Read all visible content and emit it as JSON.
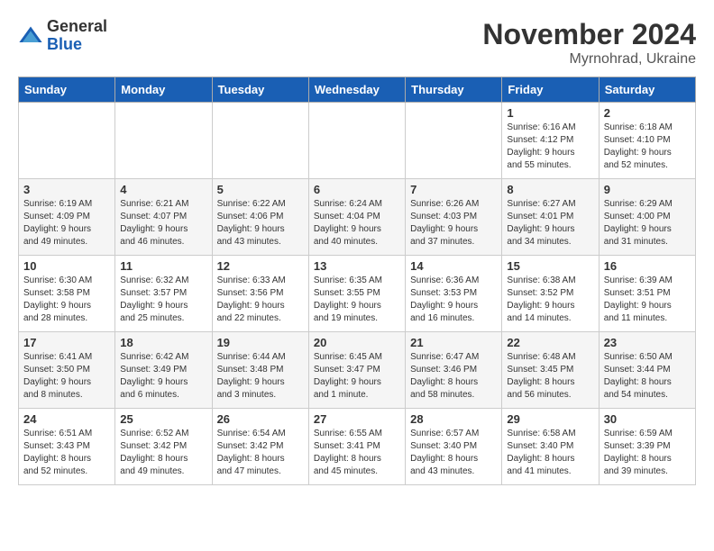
{
  "logo": {
    "general": "General",
    "blue": "Blue"
  },
  "title": "November 2024",
  "subtitle": "Myrnohrad, Ukraine",
  "days_header": [
    "Sunday",
    "Monday",
    "Tuesday",
    "Wednesday",
    "Thursday",
    "Friday",
    "Saturday"
  ],
  "weeks": [
    [
      {
        "day": "",
        "info": ""
      },
      {
        "day": "",
        "info": ""
      },
      {
        "day": "",
        "info": ""
      },
      {
        "day": "",
        "info": ""
      },
      {
        "day": "",
        "info": ""
      },
      {
        "day": "1",
        "info": "Sunrise: 6:16 AM\nSunset: 4:12 PM\nDaylight: 9 hours\nand 55 minutes."
      },
      {
        "day": "2",
        "info": "Sunrise: 6:18 AM\nSunset: 4:10 PM\nDaylight: 9 hours\nand 52 minutes."
      }
    ],
    [
      {
        "day": "3",
        "info": "Sunrise: 6:19 AM\nSunset: 4:09 PM\nDaylight: 9 hours\nand 49 minutes."
      },
      {
        "day": "4",
        "info": "Sunrise: 6:21 AM\nSunset: 4:07 PM\nDaylight: 9 hours\nand 46 minutes."
      },
      {
        "day": "5",
        "info": "Sunrise: 6:22 AM\nSunset: 4:06 PM\nDaylight: 9 hours\nand 43 minutes."
      },
      {
        "day": "6",
        "info": "Sunrise: 6:24 AM\nSunset: 4:04 PM\nDaylight: 9 hours\nand 40 minutes."
      },
      {
        "day": "7",
        "info": "Sunrise: 6:26 AM\nSunset: 4:03 PM\nDaylight: 9 hours\nand 37 minutes."
      },
      {
        "day": "8",
        "info": "Sunrise: 6:27 AM\nSunset: 4:01 PM\nDaylight: 9 hours\nand 34 minutes."
      },
      {
        "day": "9",
        "info": "Sunrise: 6:29 AM\nSunset: 4:00 PM\nDaylight: 9 hours\nand 31 minutes."
      }
    ],
    [
      {
        "day": "10",
        "info": "Sunrise: 6:30 AM\nSunset: 3:58 PM\nDaylight: 9 hours\nand 28 minutes."
      },
      {
        "day": "11",
        "info": "Sunrise: 6:32 AM\nSunset: 3:57 PM\nDaylight: 9 hours\nand 25 minutes."
      },
      {
        "day": "12",
        "info": "Sunrise: 6:33 AM\nSunset: 3:56 PM\nDaylight: 9 hours\nand 22 minutes."
      },
      {
        "day": "13",
        "info": "Sunrise: 6:35 AM\nSunset: 3:55 PM\nDaylight: 9 hours\nand 19 minutes."
      },
      {
        "day": "14",
        "info": "Sunrise: 6:36 AM\nSunset: 3:53 PM\nDaylight: 9 hours\nand 16 minutes."
      },
      {
        "day": "15",
        "info": "Sunrise: 6:38 AM\nSunset: 3:52 PM\nDaylight: 9 hours\nand 14 minutes."
      },
      {
        "day": "16",
        "info": "Sunrise: 6:39 AM\nSunset: 3:51 PM\nDaylight: 9 hours\nand 11 minutes."
      }
    ],
    [
      {
        "day": "17",
        "info": "Sunrise: 6:41 AM\nSunset: 3:50 PM\nDaylight: 9 hours\nand 8 minutes."
      },
      {
        "day": "18",
        "info": "Sunrise: 6:42 AM\nSunset: 3:49 PM\nDaylight: 9 hours\nand 6 minutes."
      },
      {
        "day": "19",
        "info": "Sunrise: 6:44 AM\nSunset: 3:48 PM\nDaylight: 9 hours\nand 3 minutes."
      },
      {
        "day": "20",
        "info": "Sunrise: 6:45 AM\nSunset: 3:47 PM\nDaylight: 9 hours\nand 1 minute."
      },
      {
        "day": "21",
        "info": "Sunrise: 6:47 AM\nSunset: 3:46 PM\nDaylight: 8 hours\nand 58 minutes."
      },
      {
        "day": "22",
        "info": "Sunrise: 6:48 AM\nSunset: 3:45 PM\nDaylight: 8 hours\nand 56 minutes."
      },
      {
        "day": "23",
        "info": "Sunrise: 6:50 AM\nSunset: 3:44 PM\nDaylight: 8 hours\nand 54 minutes."
      }
    ],
    [
      {
        "day": "24",
        "info": "Sunrise: 6:51 AM\nSunset: 3:43 PM\nDaylight: 8 hours\nand 52 minutes."
      },
      {
        "day": "25",
        "info": "Sunrise: 6:52 AM\nSunset: 3:42 PM\nDaylight: 8 hours\nand 49 minutes."
      },
      {
        "day": "26",
        "info": "Sunrise: 6:54 AM\nSunset: 3:42 PM\nDaylight: 8 hours\nand 47 minutes."
      },
      {
        "day": "27",
        "info": "Sunrise: 6:55 AM\nSunset: 3:41 PM\nDaylight: 8 hours\nand 45 minutes."
      },
      {
        "day": "28",
        "info": "Sunrise: 6:57 AM\nSunset: 3:40 PM\nDaylight: 8 hours\nand 43 minutes."
      },
      {
        "day": "29",
        "info": "Sunrise: 6:58 AM\nSunset: 3:40 PM\nDaylight: 8 hours\nand 41 minutes."
      },
      {
        "day": "30",
        "info": "Sunrise: 6:59 AM\nSunset: 3:39 PM\nDaylight: 8 hours\nand 39 minutes."
      }
    ]
  ]
}
